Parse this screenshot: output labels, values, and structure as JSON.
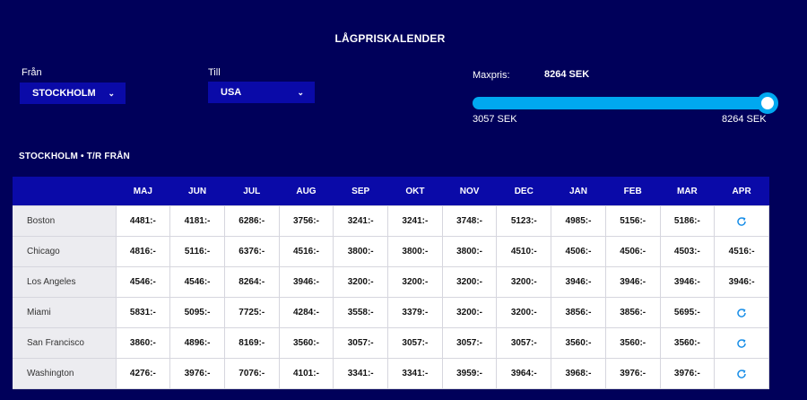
{
  "header": {
    "title": "LÅGPRISKALENDER"
  },
  "filters": {
    "from": {
      "label": "Från",
      "value": "STOCKHOLM"
    },
    "to": {
      "label": "Till",
      "value": "USA"
    }
  },
  "price_slider": {
    "label": "Maxpris:",
    "value": "8264 SEK",
    "min_label": "3057 SEK",
    "max_label": "8264 SEK",
    "level": 1.0,
    "accent_color": "#00a8f0"
  },
  "section": {
    "title": "STOCKHOLM • T/R FRÅN"
  },
  "calendar": {
    "months": [
      "MAJ",
      "JUN",
      "JUL",
      "AUG",
      "SEP",
      "OKT",
      "NOV",
      "DEC",
      "JAN",
      "FEB",
      "MAR",
      "APR"
    ],
    "rows": [
      {
        "city": "Boston",
        "prices": [
          "4481:-",
          "4181:-",
          "6286:-",
          "3756:-",
          "3241:-",
          "3241:-",
          "3748:-",
          "5123:-",
          "4985:-",
          "5156:-",
          "5186:-",
          null
        ]
      },
      {
        "city": "Chicago",
        "prices": [
          "4816:-",
          "5116:-",
          "6376:-",
          "4516:-",
          "3800:-",
          "3800:-",
          "3800:-",
          "4510:-",
          "4506:-",
          "4506:-",
          "4503:-",
          "4516:-"
        ]
      },
      {
        "city": "Los Angeles",
        "prices": [
          "4546:-",
          "4546:-",
          "8264:-",
          "3946:-",
          "3200:-",
          "3200:-",
          "3200:-",
          "3200:-",
          "3946:-",
          "3946:-",
          "3946:-",
          "3946:-"
        ]
      },
      {
        "city": "Miami",
        "prices": [
          "5831:-",
          "5095:-",
          "7725:-",
          "4284:-",
          "3558:-",
          "3379:-",
          "3200:-",
          "3200:-",
          "3856:-",
          "3856:-",
          "5695:-",
          null
        ]
      },
      {
        "city": "San Francisco",
        "prices": [
          "3860:-",
          "4896:-",
          "8169:-",
          "3560:-",
          "3057:-",
          "3057:-",
          "3057:-",
          "3057:-",
          "3560:-",
          "3560:-",
          "3560:-",
          null
        ]
      },
      {
        "city": "Washington",
        "prices": [
          "4276:-",
          "3976:-",
          "7076:-",
          "4101:-",
          "3341:-",
          "3341:-",
          "3959:-",
          "3964:-",
          "3968:-",
          "3976:-",
          "3976:-",
          null
        ]
      }
    ],
    "loading_icon": "refresh-icon"
  }
}
